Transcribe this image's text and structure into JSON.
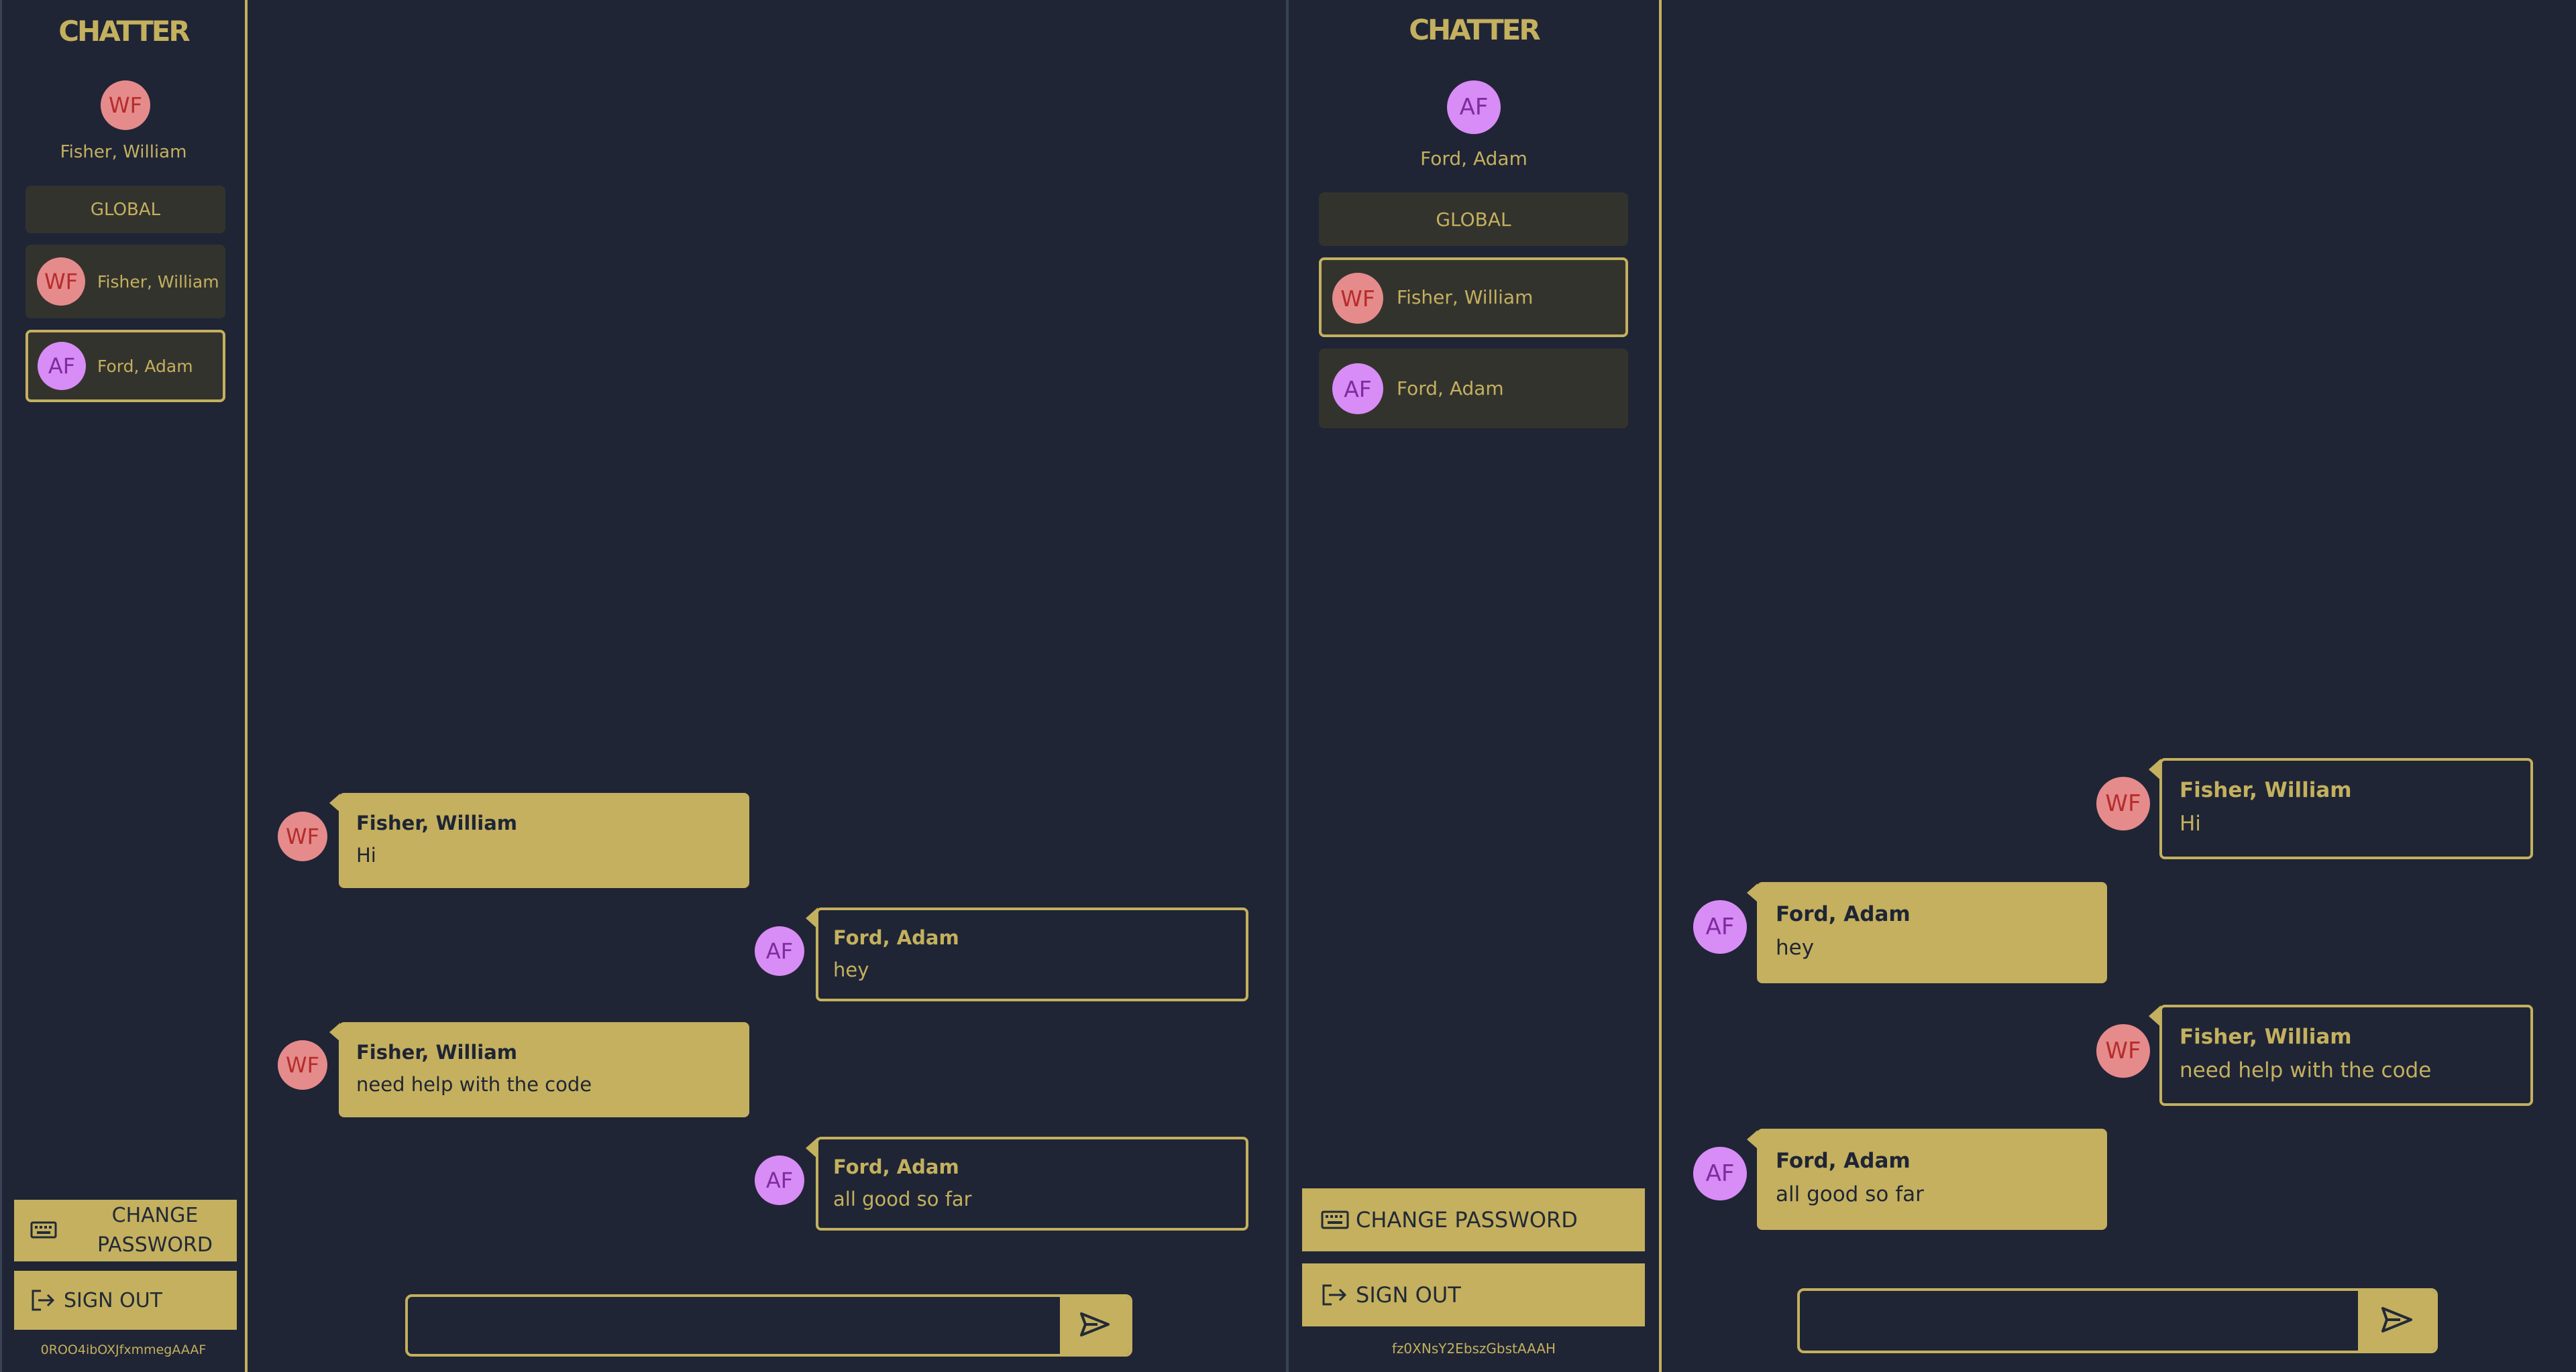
{
  "brand": "CHATTER",
  "left": {
    "user": {
      "initials": "WF",
      "name": "Fisher, William"
    },
    "global_label": "GLOBAL",
    "contacts": [
      {
        "initials": "WF",
        "name": "Fisher, William"
      },
      {
        "initials": "AF",
        "name": "Ford, Adam"
      }
    ],
    "change_password": "CHANGE PASSWORD",
    "sign_out": "SIGN OUT",
    "session_id": "0ROO4ibOXJfxmmegAAAF",
    "messages": [
      {
        "initials": "WF",
        "name": "Fisher, William",
        "text": "Hi"
      },
      {
        "initials": "AF",
        "name": "Ford, Adam",
        "text": "hey"
      },
      {
        "initials": "WF",
        "name": "Fisher, William",
        "text": "need help with the code"
      },
      {
        "initials": "AF",
        "name": "Ford, Adam",
        "text": "all good so far"
      }
    ],
    "composer_value": ""
  },
  "right": {
    "user": {
      "initials": "AF",
      "name": "Ford, Adam"
    },
    "global_label": "GLOBAL",
    "contacts": [
      {
        "initials": "WF",
        "name": "Fisher, William"
      },
      {
        "initials": "AF",
        "name": "Ford, Adam"
      }
    ],
    "change_password": "CHANGE PASSWORD",
    "sign_out": "SIGN OUT",
    "session_id": "fz0XNsY2EbszGbstAAAH",
    "messages": [
      {
        "initials": "WF",
        "name": "Fisher, William",
        "text": "Hi"
      },
      {
        "initials": "AF",
        "name": "Ford, Adam",
        "text": "hey"
      },
      {
        "initials": "WF",
        "name": "Fisher, William",
        "text": "need help with the code"
      },
      {
        "initials": "AF",
        "name": "Ford, Adam",
        "text": "all good so far"
      }
    ],
    "composer_value": ""
  },
  "colors": {
    "background": "#1f2535",
    "accent": "#c4b05e",
    "nav_box": "#33332e",
    "wf_avatar": "#e58b8b",
    "af_avatar": "#d88cf5"
  },
  "icons": {
    "change_password": "keyboard-icon",
    "sign_out": "sign-out-icon",
    "send": "send-icon"
  }
}
